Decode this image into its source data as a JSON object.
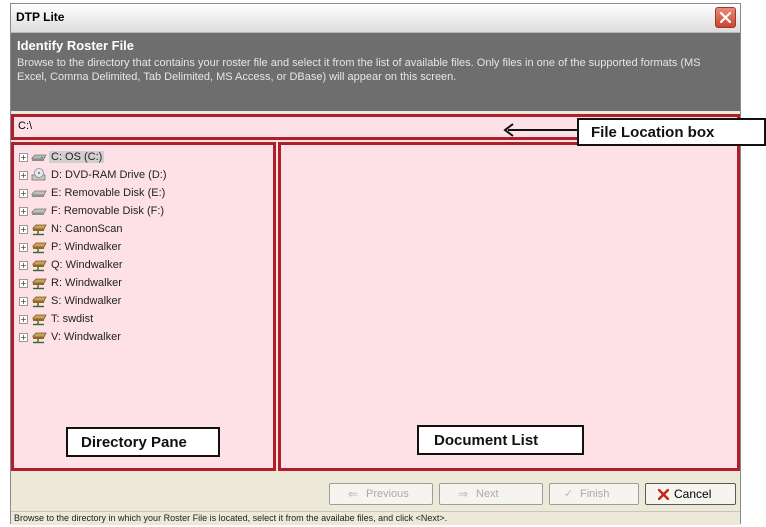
{
  "window": {
    "title": "DTP Lite"
  },
  "header": {
    "title": "Identify Roster File",
    "description": "Browse to the directory that contains your roster file and select it from the list of available files.  Only files in one of the supported formats (MS Excel, Comma Delimited, Tab Delimited, MS Access, or DBase) will appear on this screen."
  },
  "location": {
    "value": "C:\\"
  },
  "tree": {
    "items": [
      {
        "label": "C:  OS (C:)",
        "icon": "hard-drive-icon"
      },
      {
        "label": "D:  DVD-RAM Drive (D:)",
        "icon": "dvd-drive-icon"
      },
      {
        "label": "E:  Removable Disk (E:)",
        "icon": "removable-disk-icon"
      },
      {
        "label": "F:  Removable Disk (F:)",
        "icon": "removable-disk-icon"
      },
      {
        "label": "N:  CanonScan",
        "icon": "network-drive-icon"
      },
      {
        "label": "P:  Windwalker",
        "icon": "network-drive-icon"
      },
      {
        "label": "Q:  Windwalker",
        "icon": "network-drive-icon"
      },
      {
        "label": "R:  Windwalker",
        "icon": "network-drive-icon"
      },
      {
        "label": "S:  Windwalker",
        "icon": "network-drive-icon"
      },
      {
        "label": "T:  swdist",
        "icon": "network-drive-icon"
      },
      {
        "label": "V:  Windwalker",
        "icon": "network-drive-icon"
      }
    ]
  },
  "callouts": {
    "file_location": "File Location box",
    "directory_pane": "Directory Pane",
    "document_list": "Document List"
  },
  "buttons": {
    "previous": "Previous",
    "next": "Next",
    "finish": "Finish",
    "cancel": "Cancel"
  },
  "status": {
    "text": "Browse to the directory in which your Roster File is located, select it from the availabe files, and click <Next>."
  },
  "colors": {
    "highlight_border": "#b01d2b",
    "highlight_fill": "#fde1e6",
    "header_bg": "#6e6e6e"
  }
}
